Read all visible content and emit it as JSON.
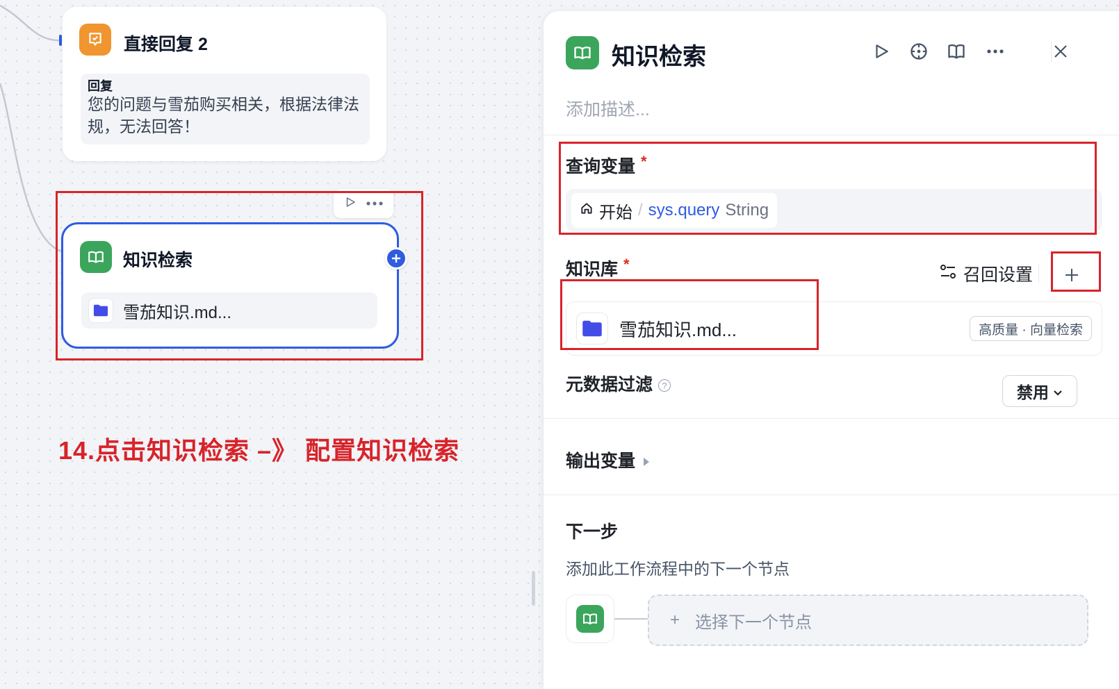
{
  "canvas": {
    "reply_node": {
      "title": "直接回复 2",
      "label": "回复",
      "text": "您的问题与雪茄购买相关，根据法律法规，无法回答！"
    },
    "kb_node": {
      "title": "知识检索",
      "file": "雪茄知识.md..."
    },
    "annotation": "14.点击知识检索 –》 配置知识检索"
  },
  "panel": {
    "title": "知识检索",
    "description_placeholder": "添加描述...",
    "query_variable": {
      "label": "查询变量",
      "required_mark": "*",
      "source": "开始",
      "separator": "/",
      "name": "sys.query",
      "type": "String"
    },
    "knowledge": {
      "label": "知识库",
      "required_mark": "*",
      "recall_label": "召回设置",
      "item_name": "雪茄知识.md...",
      "item_badge": "高质量 · 向量检索"
    },
    "metadata_filter": {
      "label": "元数据过滤",
      "help": "?",
      "value": "禁用"
    },
    "output": {
      "label": "输出变量"
    },
    "next_step": {
      "label": "下一步",
      "description": "添加此工作流程中的下一个节点",
      "plus": "+",
      "select_label": "选择下一个节点"
    }
  },
  "colors": {
    "accent": "#2f5ce0",
    "kb_green": "#3ba55c",
    "reply_orange": "#f0952f",
    "annotation_red": "#d8232a"
  }
}
